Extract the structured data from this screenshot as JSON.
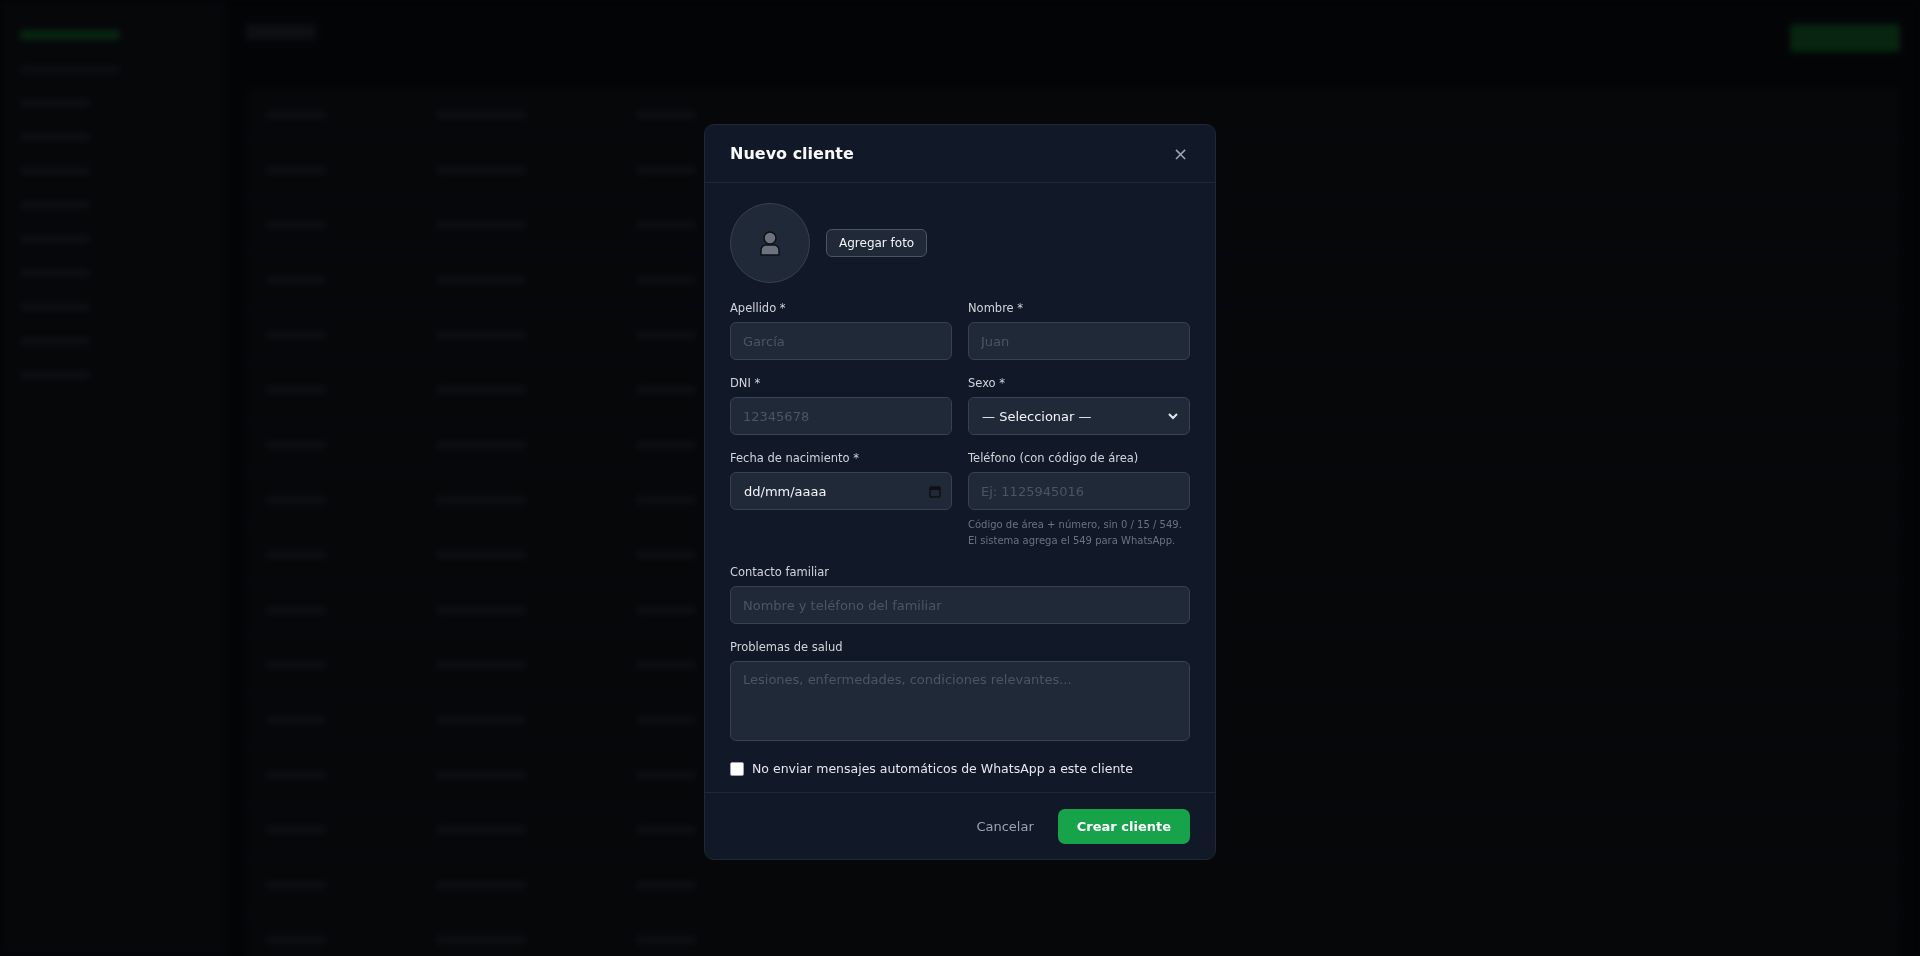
{
  "modal": {
    "title": "Nuevo cliente",
    "close": "×",
    "photo_button": "Agregar foto",
    "grid_fields": [
      {
        "kind": "text",
        "label": "Apellido *",
        "placeholder": "García"
      },
      {
        "kind": "text",
        "label": "Nombre *",
        "placeholder": "Juan"
      },
      {
        "kind": "text",
        "label": "DNI *",
        "placeholder": "12345678"
      },
      {
        "kind": "select",
        "label": "Sexo *",
        "value": "— Seleccionar —"
      },
      {
        "kind": "date",
        "label": "Fecha de nacimiento *",
        "value": "dd/mm/aaaa"
      },
      {
        "kind": "text",
        "label": "Teléfono (con código de área)",
        "placeholder": "Ej: 1125945016",
        "hint": "Código de área + número, sin 0 / 15 / 549. El sistema agrega el 549 para WhatsApp."
      }
    ],
    "wide_fields": [
      {
        "kind": "text",
        "label": "Contacto familiar",
        "placeholder": "Nombre y teléfono del familiar"
      },
      {
        "kind": "textarea",
        "label": "Problemas de salud",
        "placeholder": "Lesiones, enfermedades, condiciones relevantes..."
      }
    ],
    "checkbox": {
      "label": "No enviar mensajes automáticos de WhatsApp a este cliente",
      "checked": false
    },
    "buttons": [
      {
        "kind": "secondary",
        "label": "Cancelar"
      },
      {
        "kind": "primary",
        "label": "Crear cliente"
      }
    ]
  }
}
